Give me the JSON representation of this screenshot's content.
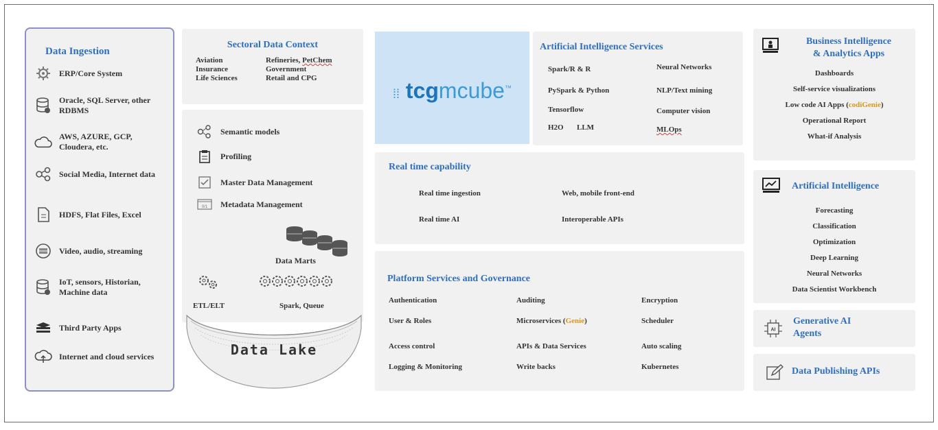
{
  "ingestion": {
    "title": "Data Ingestion",
    "items": [
      {
        "label": "ERP/Core System",
        "icon": "erp-gear-icon"
      },
      {
        "label": "Oracle, SQL Server, other RDBMS",
        "icon": "database-icon"
      },
      {
        "label": "AWS, AZURE, GCP, Cloudera, etc.",
        "icon": "cloud-icon"
      },
      {
        "label": "Social Media, Internet data",
        "icon": "social-network-icon"
      },
      {
        "label": "HDFS, Flat Files, Excel",
        "icon": "file-icon"
      },
      {
        "label": "Video, audio, streaming",
        "icon": "media-icon"
      },
      {
        "label": "IoT, sensors, Historian, Machine data",
        "icon": "iot-database-icon"
      },
      {
        "label": "Third Party Apps",
        "icon": "apps-stack-icon"
      },
      {
        "label": "Internet and cloud services",
        "icon": "cloud-upload-icon"
      }
    ]
  },
  "sectoral": {
    "title": "Sectoral Data Context",
    "col1": [
      "Aviation",
      "Insurance",
      "Life Sciences"
    ],
    "col2_row1_a": "Refineries, ",
    "col2_row1_b": "PetChem",
    "col2": [
      "Government",
      "Retail and CPG"
    ]
  },
  "datamgmt": {
    "items": [
      {
        "label": "Semantic models",
        "icon": "semantic-model-icon"
      },
      {
        "label": "Profiling",
        "icon": "clipboard-icon"
      },
      {
        "label": "Master Data Management",
        "icon": "checkbox-icon"
      },
      {
        "label": "Metadata Management",
        "icon": "metadata-icon"
      }
    ],
    "data_marts": "Data Marts",
    "etl": "ETL/ELT",
    "spark": "Spark, Queue",
    "lake": "Data Lake"
  },
  "logo": {
    "prefix": "tcg",
    "suffix": "mcube",
    "tm": "™"
  },
  "ai_services": {
    "title": "Artificial Intelligence Services",
    "left": [
      "Spark/R & R",
      "PySpark & Python",
      "Tensorflow"
    ],
    "h2o": "H2O",
    "llm": "LLM",
    "right": [
      "Neural Networks",
      "NLP/Text mining",
      "Computer vision"
    ],
    "mlops": "MLOps"
  },
  "realtime": {
    "title": "Real time capability",
    "items": [
      "Real time ingestion",
      "Web, mobile front-end",
      "Real time AI",
      "Interoperable APIs"
    ]
  },
  "platform": {
    "title": "Platform Services and Governance",
    "col1": [
      "Authentication",
      "User & Roles",
      "Access control",
      "Logging & Monitoring"
    ],
    "col2": [
      "Auditing",
      "Microservices (",
      "APIs & Data Services",
      "Write backs"
    ],
    "genie": "Genie",
    "close_paren": ")",
    "col3": [
      "Encryption",
      "Scheduler",
      "Auto scaling",
      "Kubernetes"
    ]
  },
  "bi": {
    "title_line1": "Business Intelligence",
    "title_line2": "& Analytics Apps",
    "items": [
      "Dashboards",
      "Self-service visualizations",
      "Operational Report",
      "What-if Analysis"
    ],
    "lowcode_a": "Low code AI Apps (",
    "lowcode_hl": "codiGenie",
    "lowcode_b": ")"
  },
  "ai": {
    "title": "Artificial Intelligence",
    "items": [
      "Forecasting",
      "Classification",
      "Optimization",
      "Deep Learning",
      "Neural Networks",
      "Data Scientist Workbench"
    ]
  },
  "genai": {
    "line1": "Generative AI",
    "line2": "Agents"
  },
  "dpub": {
    "title": "Data Publishing APIs"
  }
}
